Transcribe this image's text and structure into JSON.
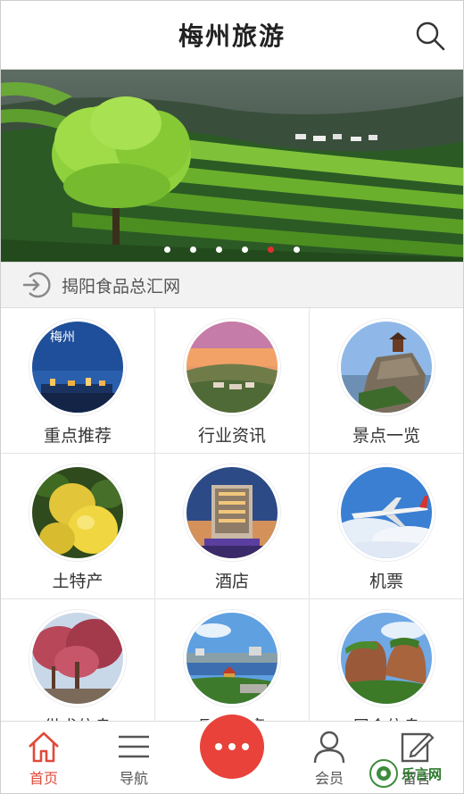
{
  "header": {
    "title": "梅州旅游",
    "search_icon": "search-icon"
  },
  "banner": {
    "dots": 6,
    "active_dot_index": 4,
    "accent": "#e62e2e"
  },
  "notice": {
    "icon": "login-arrow-icon",
    "text": "揭阳食品总汇网"
  },
  "grid": {
    "items": [
      {
        "label": "重点推荐",
        "icon": "city-night-photo"
      },
      {
        "label": "行业资讯",
        "icon": "town-sunset-photo"
      },
      {
        "label": "景点一览",
        "icon": "cliff-pagoda-photo"
      },
      {
        "label": "土特产",
        "icon": "pomelo-fruit-photo"
      },
      {
        "label": "酒店",
        "icon": "hotel-building-photo"
      },
      {
        "label": "机票",
        "icon": "airplane-photo"
      },
      {
        "label": "供求信息",
        "icon": "plum-blossom-photo"
      },
      {
        "label": "展会文章",
        "icon": "lake-town-photo"
      },
      {
        "label": "展会信息",
        "icon": "red-rock-mountain-photo"
      }
    ]
  },
  "bottom_nav": {
    "items": [
      {
        "label": "首页",
        "icon": "home-icon",
        "active": true
      },
      {
        "label": "导航",
        "icon": "menu-icon",
        "active": false
      },
      {
        "label": "会员",
        "icon": "user-icon",
        "active": false
      },
      {
        "label": "留言",
        "icon": "edit-icon",
        "active": false
      }
    ],
    "center_icon": "more-dots-icon",
    "accent": "#e8423a"
  },
  "watermark": {
    "text": "乐言网"
  }
}
